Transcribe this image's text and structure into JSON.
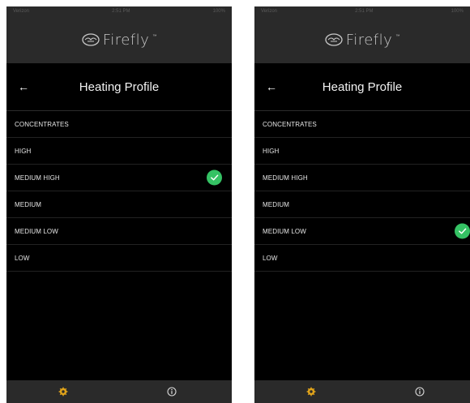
{
  "accent_color": "#35c264",
  "settings_tab_color": "#e0a31a",
  "screens": [
    {
      "status": {
        "carrier": "Verizon",
        "time": "2:51 PM",
        "battery": "100%"
      },
      "brand": {
        "name": "Firefly",
        "tm": "™"
      },
      "header": {
        "back_icon": "back-arrow-icon",
        "title": "Heating Profile"
      },
      "items": [
        {
          "label": "CONCENTRATES",
          "selected": false
        },
        {
          "label": "HIGH",
          "selected": false
        },
        {
          "label": "MEDIUM HIGH",
          "selected": true
        },
        {
          "label": "MEDIUM",
          "selected": false
        },
        {
          "label": "MEDIUM LOW",
          "selected": false
        },
        {
          "label": "LOW",
          "selected": false
        }
      ],
      "tabs": [
        {
          "icon": "gear-icon",
          "active": true
        },
        {
          "icon": "info-icon",
          "active": false
        }
      ]
    },
    {
      "status": {
        "carrier": "Verizon",
        "time": "2:51 PM",
        "battery": "100%"
      },
      "brand": {
        "name": "Firefly",
        "tm": "™"
      },
      "header": {
        "back_icon": "back-arrow-icon",
        "title": "Heating Profile"
      },
      "items": [
        {
          "label": "CONCENTRATES",
          "selected": false
        },
        {
          "label": "HIGH",
          "selected": false
        },
        {
          "label": "MEDIUM HIGH",
          "selected": false
        },
        {
          "label": "MEDIUM",
          "selected": false
        },
        {
          "label": "MEDIUM LOW",
          "selected": true
        },
        {
          "label": "LOW",
          "selected": false
        }
      ],
      "tabs": [
        {
          "icon": "gear-icon",
          "active": true
        },
        {
          "icon": "info-icon",
          "active": false
        }
      ]
    }
  ]
}
